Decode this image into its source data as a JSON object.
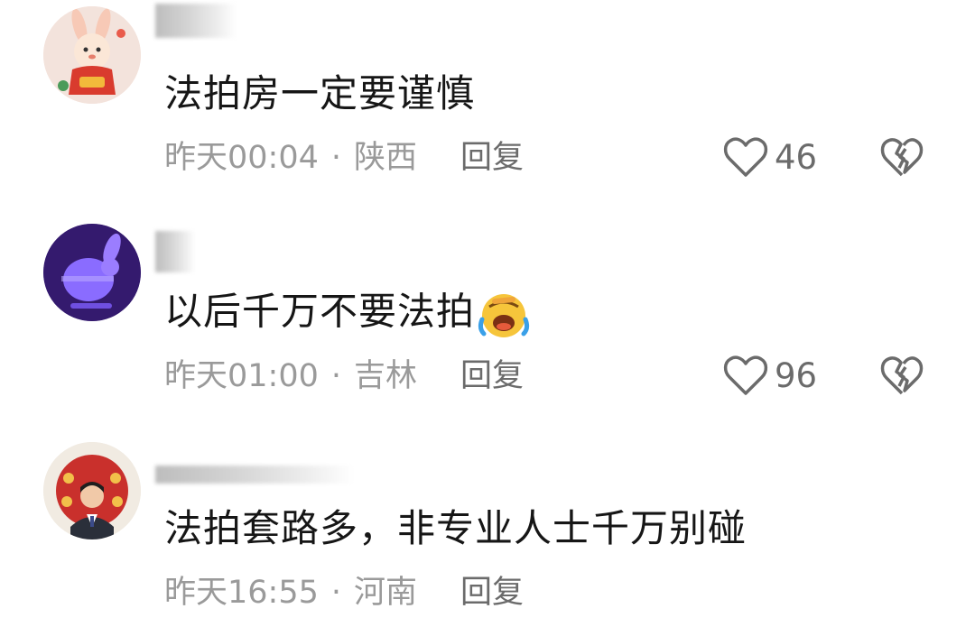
{
  "comments": [
    {
      "text": "法拍房一定要谨慎",
      "time": "昨天00:04",
      "separator": "·",
      "location": "陕西",
      "reply_label": "回复",
      "like_count": "46",
      "avatar_icon": "rabbit-cartoon-avatar"
    },
    {
      "text": "以后千万不要法拍",
      "emoji": "laughing-crying-emoji",
      "time": "昨天01:00",
      "separator": "·",
      "location": "吉林",
      "reply_label": "回复",
      "like_count": "96",
      "avatar_icon": "purple-rabbit-avatar"
    },
    {
      "text": "法拍套路多，非专业人士千万别碰",
      "time": "昨天16:55",
      "separator": "·",
      "location": "河南",
      "reply_label": "回复",
      "avatar_icon": "man-in-suit-avatar"
    }
  ],
  "colors": {
    "text": "#161616",
    "meta": "#9a9a9a",
    "action": "#6b6b6b"
  }
}
